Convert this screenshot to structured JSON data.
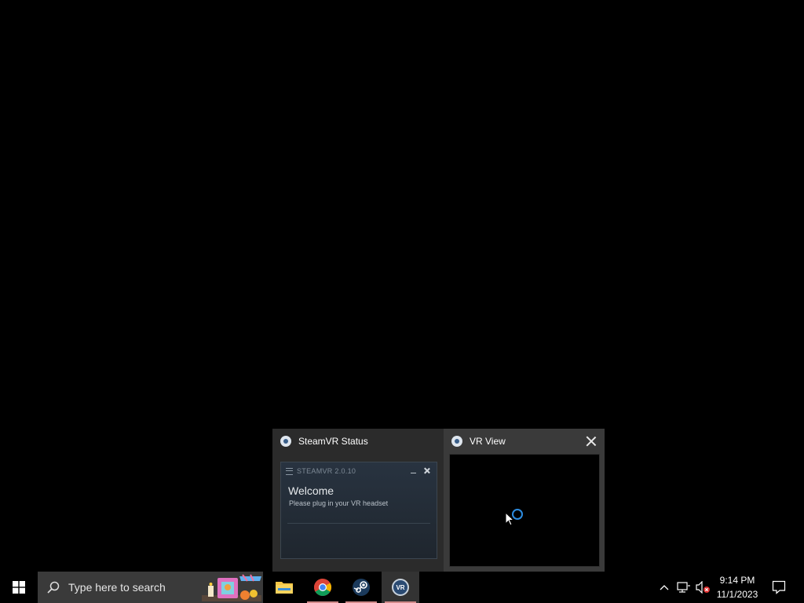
{
  "desktop": {},
  "preview": {
    "status_window": {
      "title": "SteamVR Status",
      "inner": {
        "version": "STEAMVR 2.0.10",
        "welcome": "Welcome",
        "message": "Please plug in your VR headset"
      }
    },
    "vr_view_window": {
      "title": "VR View"
    }
  },
  "taskbar": {
    "search_placeholder": "Type here to search",
    "apps": [
      {
        "name": "File Explorer",
        "icon": "folder-icon"
      },
      {
        "name": "Google Chrome",
        "icon": "chrome-icon"
      },
      {
        "name": "Steam",
        "icon": "steam-icon"
      },
      {
        "name": "SteamVR",
        "icon": "steamvr-icon"
      }
    ],
    "clock": {
      "time": "9:14 PM",
      "date": "11/1/2023"
    }
  },
  "colors": {
    "taskbar_bg": "#000000",
    "search_bg": "#3a3a3a",
    "accent_spinner": "#2d8ce0",
    "underline": "#d28a8a"
  }
}
